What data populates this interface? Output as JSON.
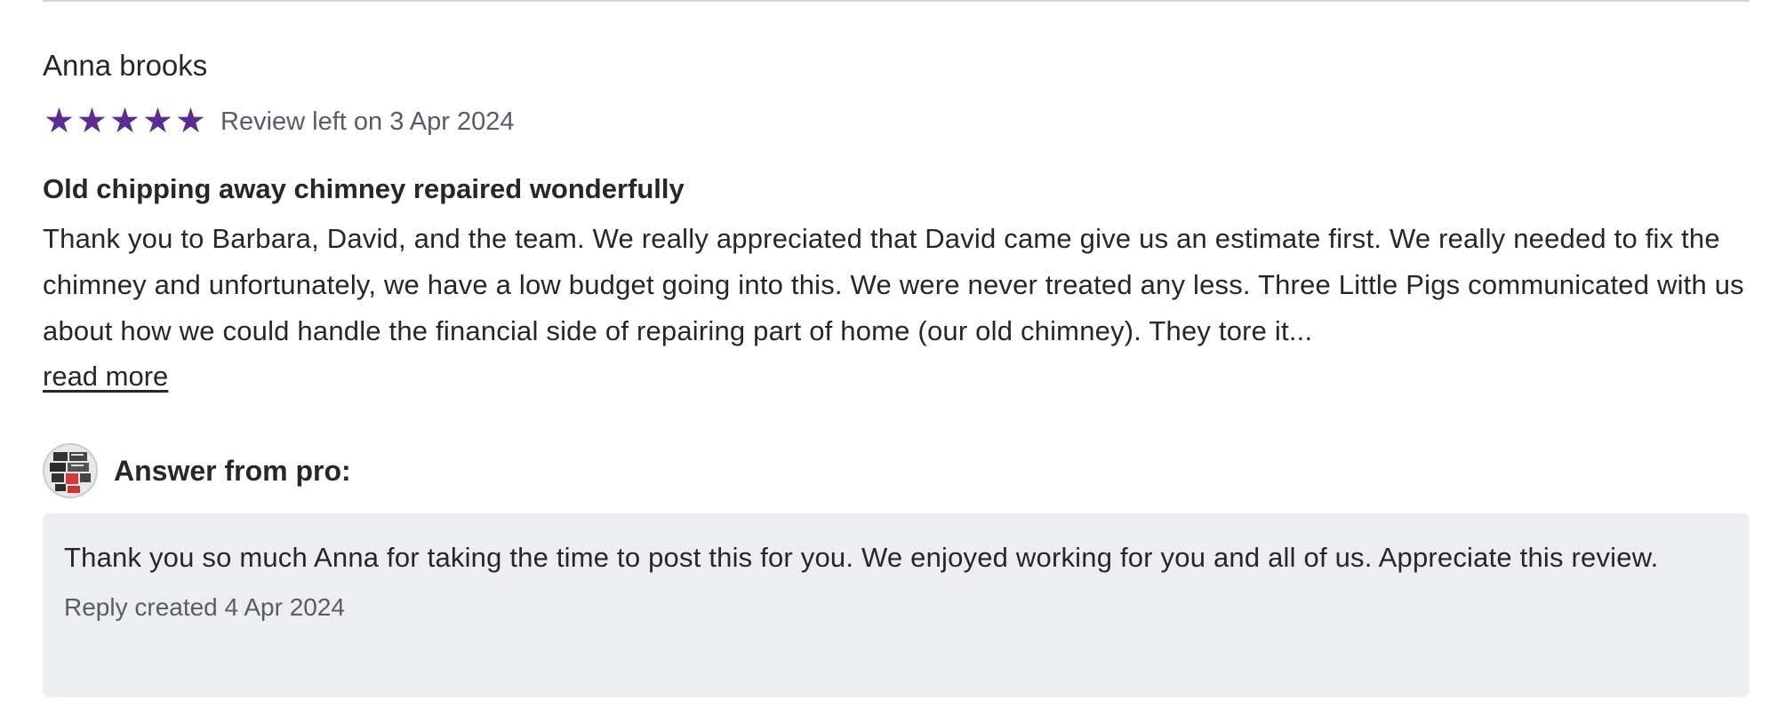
{
  "review": {
    "reviewer_name": "Anna brooks",
    "rating": 5,
    "rating_max": 5,
    "star_color": "#5c2d91",
    "date_text": "Review left on 3 Apr 2024",
    "title": "Old chipping away chimney repaired wonderfully",
    "body": "Thank you to Barbara, David, and the team. We really appreciated that David came give us an estimate first. We really needed to fix the chimney and unfortunately, we have a low budget going into this. We were never treated any less. Three Little Pigs communicated with us about how we could handle the financial side of repairing part of home (our old chimney). They tore it...",
    "read_more_label": "read more"
  },
  "pro_reply": {
    "header_label": "Answer from pro:",
    "avatar_icon": "company-logo-icon",
    "text": "Thank you so much Anna for taking the time to post this for you. We enjoyed working for you and all of us. Appreciate this review.",
    "date_text": "Reply created 4 Apr 2024"
  }
}
